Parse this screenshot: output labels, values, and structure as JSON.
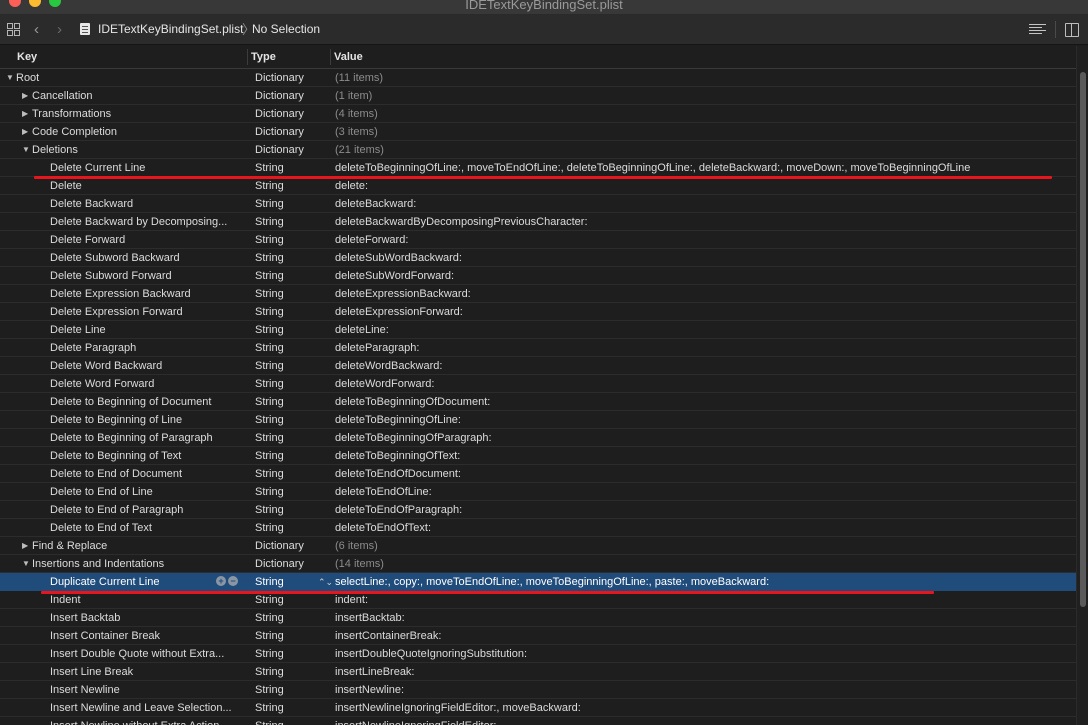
{
  "window": {
    "title": "IDETextKeyBindingSet.plist"
  },
  "jumpbar": {
    "file_name": "IDETextKeyBindingSet.plist",
    "selection": "No Selection"
  },
  "table": {
    "headers": {
      "key": "Key",
      "type": "Type",
      "value": "Value"
    },
    "rows": [
      {
        "key": "Root",
        "type": "Dictionary",
        "value": "(11 items)",
        "level": 0,
        "disclosure": "expanded",
        "muted": true
      },
      {
        "key": "Cancellation",
        "type": "Dictionary",
        "value": "(1 item)",
        "level": 1,
        "disclosure": "collapsed",
        "muted": true
      },
      {
        "key": "Transformations",
        "type": "Dictionary",
        "value": "(4 items)",
        "level": 1,
        "disclosure": "collapsed",
        "muted": true
      },
      {
        "key": "Code Completion",
        "type": "Dictionary",
        "value": "(3 items)",
        "level": 1,
        "disclosure": "collapsed",
        "muted": true
      },
      {
        "key": "Deletions",
        "type": "Dictionary",
        "value": "(21 items)",
        "level": 1,
        "disclosure": "expanded",
        "muted": true
      },
      {
        "key": "Delete Current Line",
        "type": "String",
        "value": "deleteToBeginningOfLine:, moveToEndOfLine:, deleteToBeginningOfLine:, deleteBackward:, moveDown:, moveToBeginningOfLine",
        "level": 2
      },
      {
        "key": "Delete",
        "type": "String",
        "value": "delete:",
        "level": 2
      },
      {
        "key": "Delete Backward",
        "type": "String",
        "value": "deleteBackward:",
        "level": 2
      },
      {
        "key": "Delete Backward by Decomposing...",
        "type": "String",
        "value": "deleteBackwardByDecomposingPreviousCharacter:",
        "level": 2
      },
      {
        "key": "Delete Forward",
        "type": "String",
        "value": "deleteForward:",
        "level": 2
      },
      {
        "key": "Delete Subword Backward",
        "type": "String",
        "value": "deleteSubWordBackward:",
        "level": 2
      },
      {
        "key": "Delete Subword Forward",
        "type": "String",
        "value": "deleteSubWordForward:",
        "level": 2
      },
      {
        "key": "Delete Expression Backward",
        "type": "String",
        "value": "deleteExpressionBackward:",
        "level": 2
      },
      {
        "key": "Delete Expression Forward",
        "type": "String",
        "value": "deleteExpressionForward:",
        "level": 2
      },
      {
        "key": "Delete Line",
        "type": "String",
        "value": "deleteLine:",
        "level": 2
      },
      {
        "key": "Delete Paragraph",
        "type": "String",
        "value": "deleteParagraph:",
        "level": 2
      },
      {
        "key": "Delete Word Backward",
        "type": "String",
        "value": "deleteWordBackward:",
        "level": 2
      },
      {
        "key": "Delete Word Forward",
        "type": "String",
        "value": "deleteWordForward:",
        "level": 2
      },
      {
        "key": "Delete to Beginning of Document",
        "type": "String",
        "value": "deleteToBeginningOfDocument:",
        "level": 2
      },
      {
        "key": "Delete to Beginning of Line",
        "type": "String",
        "value": "deleteToBeginningOfLine:",
        "level": 2
      },
      {
        "key": "Delete to Beginning of Paragraph",
        "type": "String",
        "value": "deleteToBeginningOfParagraph:",
        "level": 2
      },
      {
        "key": "Delete to Beginning of Text",
        "type": "String",
        "value": "deleteToBeginningOfText:",
        "level": 2
      },
      {
        "key": "Delete to End of Document",
        "type": "String",
        "value": "deleteToEndOfDocument:",
        "level": 2
      },
      {
        "key": "Delete to End of Line",
        "type": "String",
        "value": "deleteToEndOfLine:",
        "level": 2
      },
      {
        "key": "Delete to End of Paragraph",
        "type": "String",
        "value": "deleteToEndOfParagraph:",
        "level": 2
      },
      {
        "key": "Delete to End of Text",
        "type": "String",
        "value": "deleteToEndOfText:",
        "level": 2
      },
      {
        "key": "Find & Replace",
        "type": "Dictionary",
        "value": "(6 items)",
        "level": 1,
        "disclosure": "collapsed",
        "muted": true
      },
      {
        "key": "Insertions and Indentations",
        "type": "Dictionary",
        "value": "(14 items)",
        "level": 1,
        "disclosure": "expanded",
        "muted": true
      },
      {
        "key": "Duplicate Current Line",
        "type": "String",
        "value": "selectLine:, copy:, moveToEndOfLine:, moveToBeginningOfLine:, paste:, moveBackward:",
        "level": 2,
        "selected": true
      },
      {
        "key": "Indent",
        "type": "String",
        "value": "indent:",
        "level": 2
      },
      {
        "key": "Insert Backtab",
        "type": "String",
        "value": "insertBacktab:",
        "level": 2
      },
      {
        "key": "Insert Container Break",
        "type": "String",
        "value": "insertContainerBreak:",
        "level": 2
      },
      {
        "key": "Insert Double Quote without Extra...",
        "type": "String",
        "value": "insertDoubleQuoteIgnoringSubstitution:",
        "level": 2
      },
      {
        "key": "Insert Line Break",
        "type": "String",
        "value": "insertLineBreak:",
        "level": 2
      },
      {
        "key": "Insert Newline",
        "type": "String",
        "value": "insertNewline:",
        "level": 2
      },
      {
        "key": "Insert Newline and Leave Selection...",
        "type": "String",
        "value": "insertNewlineIgnoringFieldEditor:, moveBackward:",
        "level": 2
      },
      {
        "key": "Insert Newline without Extra Action",
        "type": "String",
        "value": "insertNewlineIgnoringFieldEditor:",
        "level": 2
      }
    ]
  },
  "colors": {
    "background": "#1e1e1e",
    "selection": "#204c7c",
    "annotation": "#e8161c"
  }
}
